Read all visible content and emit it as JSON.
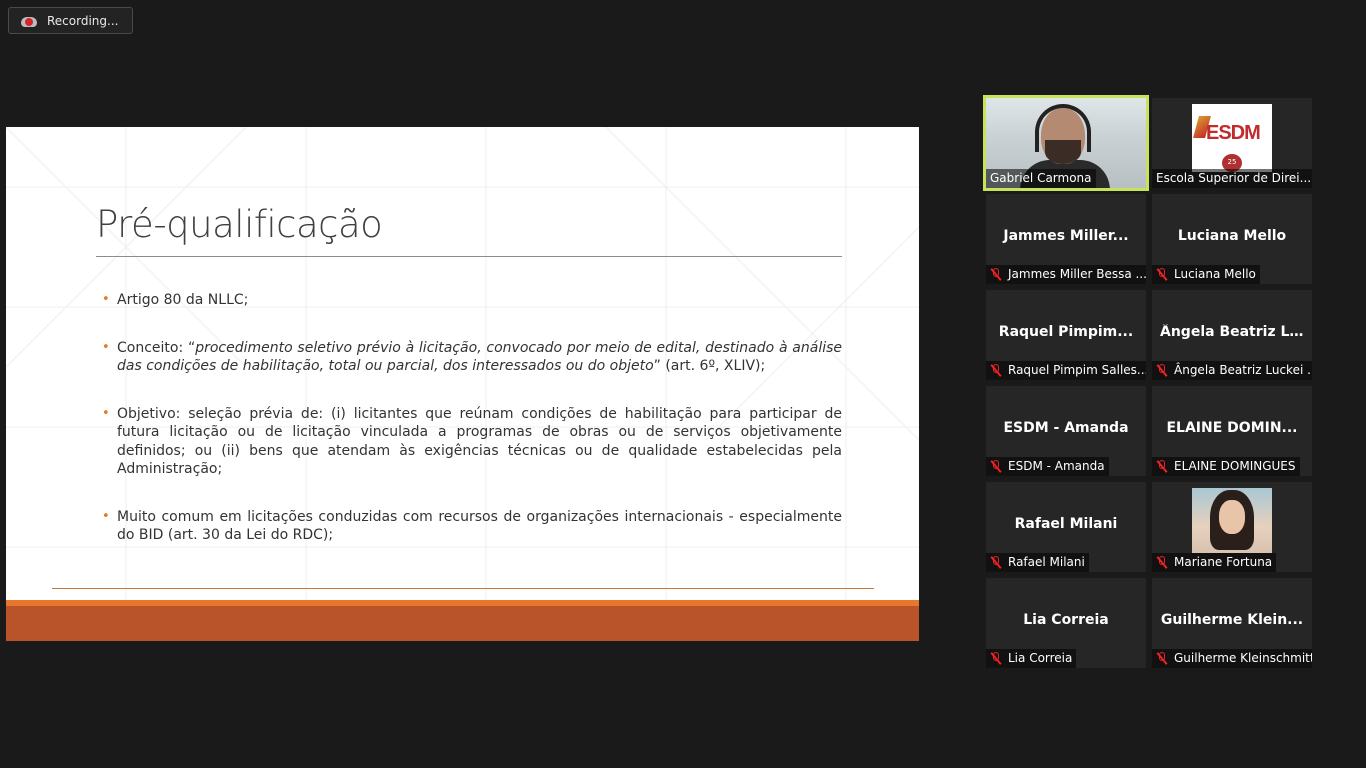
{
  "recording": {
    "label": "Recording..."
  },
  "slide": {
    "title": "Pré-qualificação",
    "bullets": [
      {
        "text": "Artigo 80 da NLLC;"
      },
      {
        "prefix": "Conceito: “",
        "italic": "procedimento seletivo prévio à licitação, convocado por meio de edital, destinado à análise das condições de habilitação, total ou parcial, dos interessados ou do objeto",
        "suffix": "” (art. 6º, XLIV);"
      },
      {
        "text": "Objetivo: seleção prévia de: (i) licitantes que reúnam condições de habilitação para participar de futura licitação ou de licitação vinculada a programas de obras ou de serviços objetivamente definidos; ou (ii) bens que atendam às exigências técnicas ou de qualidade estabelecidas pela Administração;"
      },
      {
        "text": "Muito comum em licitações conduzidas com recursos de organizações internacionais - especialmente do BID (art. 30 da Lei do RDC);"
      }
    ],
    "colors": {
      "accent": "#e07b2a",
      "band": "#b8532a"
    }
  },
  "participants": [
    {
      "big": "",
      "label": "Gabriel Carmona",
      "muted": false,
      "video": "person"
    },
    {
      "big": "",
      "label": "Escola Superior de Direi...",
      "muted": false,
      "video": "esdm-logo",
      "logo_text": "ESDM",
      "badge": "25"
    },
    {
      "big": "Jammes  Miller...",
      "label": "Jammes Miller Bessa ...",
      "muted": true
    },
    {
      "big": "Luciana Mello",
      "label": "Luciana Mello",
      "muted": true
    },
    {
      "big": "Raquel  Pimpim...",
      "label": "Raquel Pimpim Salles...",
      "muted": true
    },
    {
      "big": "Ângela Beatriz L...",
      "label": "Ângela Beatriz Luckei ...",
      "muted": true
    },
    {
      "big": "ESDM - Amanda",
      "label": "ESDM - Amanda",
      "muted": true
    },
    {
      "big": "ELAINE  DOMIN...",
      "label": "ELAINE DOMINGUES",
      "muted": true
    },
    {
      "big": "Rafael Milani",
      "label": "Rafael Milani",
      "muted": true
    },
    {
      "big": "",
      "label": "Mariane Fortuna",
      "muted": true,
      "video": "photo"
    },
    {
      "big": "Lia Correia",
      "label": "Lia Correia",
      "muted": true
    },
    {
      "big": "Guilherme  Klein...",
      "label": "Guilherme Kleinschmitt",
      "muted": true
    }
  ]
}
